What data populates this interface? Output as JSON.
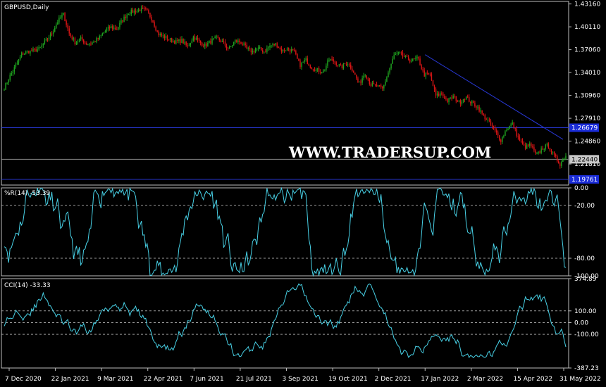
{
  "chart_data": {
    "type": "candlestick",
    "symbol_label": "GBPUSD,Daily",
    "watermark": "WWW.TRADERSUP.COM",
    "price_axis": {
      "ylim": [
        1.19,
        1.435
      ],
      "ticks": [
        "1.43160",
        "1.40110",
        "1.37060",
        "1.34010",
        "1.30960",
        "1.27910",
        "1.24860",
        "1.21810"
      ]
    },
    "price_markers": [
      {
        "label": "1.26679",
        "value": 1.2665,
        "kind": "hline-blue"
      },
      {
        "label": "1.22440",
        "value": 1.2244,
        "kind": "current"
      },
      {
        "label": "1.19761",
        "value": 1.1976,
        "kind": "hline-blue"
      }
    ],
    "trendline": {
      "from": {
        "date": "17 Jan 2022",
        "price": 1.364
      },
      "to": {
        "date": "7 Jun 2022",
        "price": 1.251
      }
    },
    "x_ticks": [
      "7 Dec 2020",
      "22 Jan 2021",
      "9 Mar 2021",
      "22 Apr 2021",
      "7 Jun 2021",
      "21 Jul 2021",
      "3 Sep 2021",
      "19 Oct 2021",
      "2 Dec 2021",
      "17 Jan 2022",
      "2 Mar 2022",
      "15 Apr 2022",
      "31 May 2022"
    ],
    "close_series": [
      1.32,
      1.336,
      1.35,
      1.365,
      1.368,
      1.369,
      1.372,
      1.382,
      1.392,
      1.408,
      1.418,
      1.392,
      1.38,
      1.385,
      1.378,
      1.38,
      1.386,
      1.395,
      1.401,
      1.398,
      1.41,
      1.42,
      1.422,
      1.424,
      1.423,
      1.412,
      1.392,
      1.388,
      1.384,
      1.381,
      1.383,
      1.374,
      1.388,
      1.381,
      1.376,
      1.382,
      1.386,
      1.38,
      1.371,
      1.382,
      1.381,
      1.372,
      1.368,
      1.372,
      1.368,
      1.376,
      1.378,
      1.369,
      1.372,
      1.368,
      1.35,
      1.357,
      1.347,
      1.343,
      1.342,
      1.358,
      1.354,
      1.347,
      1.354,
      1.343,
      1.324,
      1.34,
      1.324,
      1.322,
      1.318,
      1.341,
      1.364,
      1.365,
      1.359,
      1.356,
      1.359,
      1.337,
      1.338,
      1.309,
      1.312,
      1.302,
      1.308,
      1.3,
      1.308,
      1.3,
      1.295,
      1.283,
      1.274,
      1.262,
      1.25,
      1.265,
      1.272,
      1.252,
      1.24,
      1.244,
      1.229,
      1.239,
      1.243,
      1.229,
      1.218,
      1.23
    ],
    "wpr": {
      "label": "%R(14) -53.39",
      "ylim": [
        -100,
        0
      ],
      "ticks": [
        "0.00",
        "-20.00",
        "-80.00",
        "-100.00"
      ],
      "levels": [
        -20,
        -80
      ]
    },
    "cci": {
      "label": "CCI(14) -33.33",
      "ylim": [
        -387.23,
        374.89
      ],
      "ticks": [
        "374.89",
        "100.00",
        "0.00",
        "-100.00",
        "-387.23"
      ],
      "levels": [
        100,
        0,
        -100
      ]
    },
    "colors": {
      "up": "#1fa31f",
      "down": "#d91515",
      "indicator": "#48d1e6",
      "grid_dash": "#9a9a9a",
      "hline": "#2838d6",
      "trend": "#2838d6",
      "frame": "#bdbdbd",
      "marker_blue": "#1a2cd8",
      "marker_gray": "#c8c8c8"
    }
  }
}
